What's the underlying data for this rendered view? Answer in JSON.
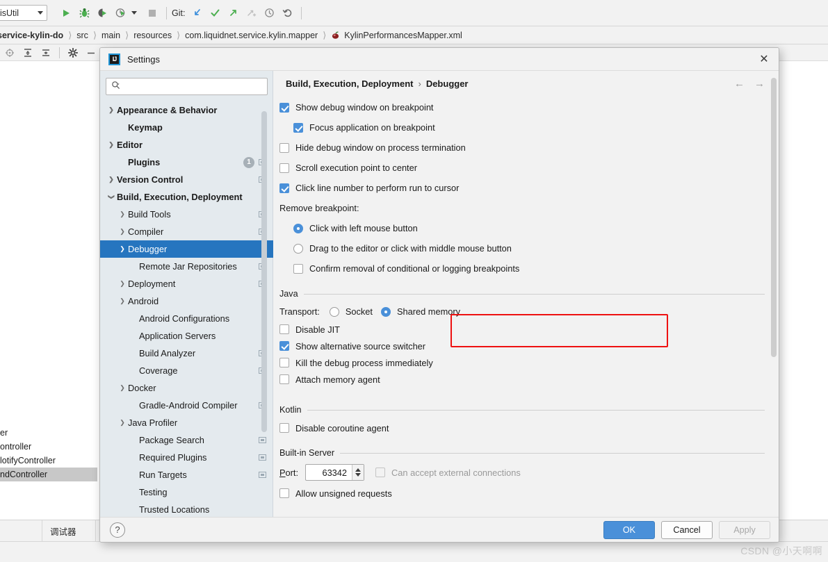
{
  "ide": {
    "toolbar": {
      "run_config": "disUtil",
      "git_label": "Git:",
      "icons": [
        "run-icon",
        "debug-icon",
        "run-with-coverage-icon",
        "profile-icon",
        "stop-icon",
        "git-update-icon",
        "git-commit-icon",
        "git-push-icon",
        "git-revert-icon",
        "git-history-icon",
        "git-rollback-icon"
      ]
    },
    "breadcrumb": {
      "items": [
        "service-kylin-do",
        "src",
        "main",
        "resources",
        "com.liquidnet.service.kylin.mapper",
        "KylinPerformancesMapper.xml"
      ]
    },
    "toolstrip_icons": [
      "locate-icon",
      "expand-all-icon",
      "collapse-all-icon",
      "settings-gear-icon",
      "hide-icon"
    ],
    "background_structure": [
      "er",
      "ontroller",
      "lotifyController",
      "ndController"
    ],
    "bottom_tab": "调试器",
    "watermark": "CSDN @小天啊啊"
  },
  "dialog": {
    "title": "Settings",
    "close_icon": "close-icon",
    "search": {
      "value": "",
      "placeholder": "",
      "icon": "search-icon"
    },
    "tree": [
      {
        "label": "Appearance & Behavior",
        "arrow": "collapsed",
        "bold": true,
        "indent": 0,
        "badge": null,
        "proj": false,
        "selected": false
      },
      {
        "label": "Keymap",
        "arrow": "none",
        "bold": true,
        "indent": 1,
        "badge": null,
        "proj": false,
        "selected": false
      },
      {
        "label": "Editor",
        "arrow": "collapsed",
        "bold": true,
        "indent": 0,
        "badge": null,
        "proj": false,
        "selected": false
      },
      {
        "label": "Plugins",
        "arrow": "none",
        "bold": true,
        "indent": 1,
        "badge": "1",
        "proj": true,
        "selected": false
      },
      {
        "label": "Version Control",
        "arrow": "collapsed",
        "bold": true,
        "indent": 0,
        "badge": null,
        "proj": true,
        "selected": false
      },
      {
        "label": "Build, Execution, Deployment",
        "arrow": "expanded",
        "bold": true,
        "indent": 0,
        "badge": null,
        "proj": false,
        "selected": false
      },
      {
        "label": "Build Tools",
        "arrow": "collapsed",
        "bold": false,
        "indent": 1,
        "badge": null,
        "proj": true,
        "selected": false
      },
      {
        "label": "Compiler",
        "arrow": "collapsed",
        "bold": false,
        "indent": 1,
        "badge": null,
        "proj": true,
        "selected": false
      },
      {
        "label": "Debugger",
        "arrow": "collapsed",
        "bold": false,
        "indent": 1,
        "badge": null,
        "proj": false,
        "selected": true
      },
      {
        "label": "Remote Jar Repositories",
        "arrow": "none",
        "bold": false,
        "indent": 2,
        "badge": null,
        "proj": true,
        "selected": false
      },
      {
        "label": "Deployment",
        "arrow": "collapsed",
        "bold": false,
        "indent": 1,
        "badge": null,
        "proj": true,
        "selected": false
      },
      {
        "label": "Android",
        "arrow": "collapsed",
        "bold": false,
        "indent": 1,
        "badge": null,
        "proj": false,
        "selected": false
      },
      {
        "label": "Android Configurations",
        "arrow": "none",
        "bold": false,
        "indent": 2,
        "badge": null,
        "proj": false,
        "selected": false
      },
      {
        "label": "Application Servers",
        "arrow": "none",
        "bold": false,
        "indent": 2,
        "badge": null,
        "proj": false,
        "selected": false
      },
      {
        "label": "Build Analyzer",
        "arrow": "none",
        "bold": false,
        "indent": 2,
        "badge": null,
        "proj": true,
        "selected": false
      },
      {
        "label": "Coverage",
        "arrow": "none",
        "bold": false,
        "indent": 2,
        "badge": null,
        "proj": true,
        "selected": false
      },
      {
        "label": "Docker",
        "arrow": "collapsed",
        "bold": false,
        "indent": 1,
        "badge": null,
        "proj": false,
        "selected": false
      },
      {
        "label": "Gradle-Android Compiler",
        "arrow": "none",
        "bold": false,
        "indent": 2,
        "badge": null,
        "proj": true,
        "selected": false
      },
      {
        "label": "Java Profiler",
        "arrow": "collapsed",
        "bold": false,
        "indent": 1,
        "badge": null,
        "proj": false,
        "selected": false
      },
      {
        "label": "Package Search",
        "arrow": "none",
        "bold": false,
        "indent": 2,
        "badge": null,
        "proj": true,
        "selected": false
      },
      {
        "label": "Required Plugins",
        "arrow": "none",
        "bold": false,
        "indent": 2,
        "badge": null,
        "proj": true,
        "selected": false
      },
      {
        "label": "Run Targets",
        "arrow": "none",
        "bold": false,
        "indent": 2,
        "badge": null,
        "proj": true,
        "selected": false
      },
      {
        "label": "Testing",
        "arrow": "none",
        "bold": false,
        "indent": 2,
        "badge": null,
        "proj": false,
        "selected": false
      },
      {
        "label": "Trusted Locations",
        "arrow": "none",
        "bold": false,
        "indent": 2,
        "badge": null,
        "proj": false,
        "selected": false
      }
    ],
    "header": {
      "parent": "Build, Execution, Deployment",
      "separator": "›",
      "current": "Debugger",
      "back_icon": "arrow-left-icon",
      "forward_icon": "arrow-right-icon"
    },
    "options": {
      "show_debug_window": {
        "label": "Show debug window on breakpoint",
        "checked": true
      },
      "focus_application": {
        "label": "Focus application on breakpoint",
        "checked": true
      },
      "hide_debug_window": {
        "label": "Hide debug window on process termination",
        "checked": false
      },
      "scroll_execution": {
        "label": "Scroll execution point to center",
        "checked": false
      },
      "click_line_number": {
        "label": "Click line number to perform run to cursor",
        "checked": true
      },
      "remove_breakpoint_label": "Remove breakpoint:",
      "remove_left_click": {
        "label": "Click with left mouse button",
        "selected": true
      },
      "remove_drag": {
        "label": "Drag to the editor or click with middle mouse button",
        "selected": false
      },
      "confirm_removal": {
        "label": "Confirm removal of conditional or logging breakpoints",
        "checked": false
      }
    },
    "java_section": {
      "title": "Java",
      "transport_label": "Transport:",
      "transport_socket": {
        "label": "Socket",
        "selected": false
      },
      "transport_shared": {
        "label": "Shared memory",
        "selected": true
      },
      "disable_jit": {
        "label": "Disable JIT",
        "checked": false
      },
      "show_alt_source": {
        "label": "Show alternative source switcher",
        "checked": true
      },
      "kill_debug": {
        "label": "Kill the debug process immediately",
        "checked": false
      },
      "attach_memory": {
        "label": "Attach memory agent",
        "checked": false
      },
      "highlight_color": "#ee1111"
    },
    "kotlin_section": {
      "title": "Kotlin",
      "disable_coroutine": {
        "label": "Disable coroutine agent",
        "checked": false
      }
    },
    "builtin_server": {
      "title": "Built-in Server",
      "port_label": "Port:",
      "port_value": "63342",
      "accept_external": {
        "label": "Can accept external connections",
        "checked": false,
        "disabled": true
      },
      "allow_unsigned": {
        "label": "Allow unsigned requests",
        "checked": false
      }
    },
    "footer": {
      "help_icon": "help-icon",
      "ok": "OK",
      "cancel": "Cancel",
      "apply": "Apply",
      "apply_disabled": true
    }
  }
}
